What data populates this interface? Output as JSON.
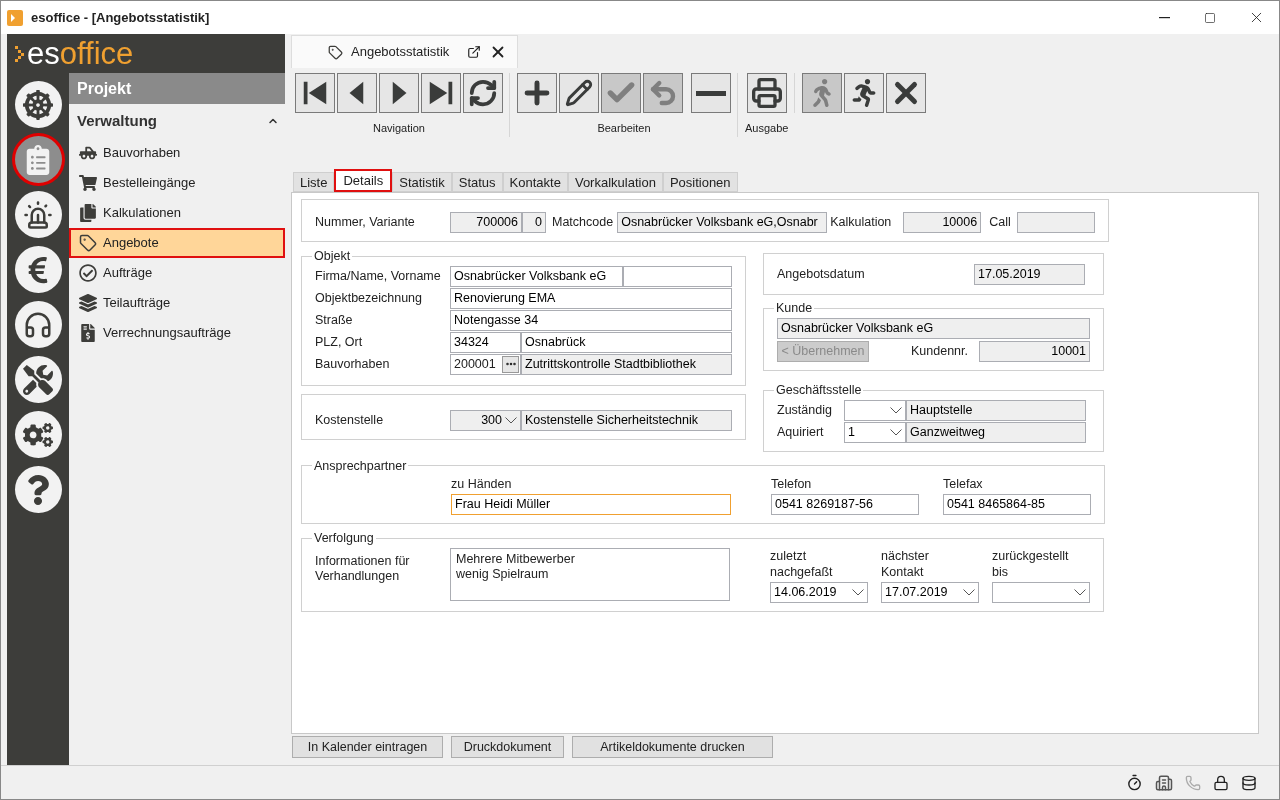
{
  "window": {
    "title": "esoffice - [Angebotsstatistik]"
  },
  "logo": {
    "prefix": "es",
    "suffix": "office"
  },
  "rail": [
    {
      "kind": "wheel",
      "selected": false
    },
    {
      "kind": "project",
      "selected": true
    },
    {
      "kind": "siren",
      "selected": false
    },
    {
      "kind": "euro",
      "selected": false
    },
    {
      "kind": "headset",
      "selected": false
    },
    {
      "kind": "tools",
      "selected": false
    },
    {
      "kind": "cogs",
      "selected": false
    },
    {
      "kind": "help",
      "selected": false
    }
  ],
  "menu": {
    "title": "Projekt",
    "group": {
      "label": "Verwaltung",
      "expanded": true
    },
    "items": [
      {
        "kind": "truck",
        "label": "Bauvorhaben",
        "selected": false
      },
      {
        "kind": "cart",
        "label": "Bestelleingänge",
        "selected": false
      },
      {
        "kind": "docs",
        "label": "Kalkulationen",
        "selected": false
      },
      {
        "kind": "tag",
        "label": "Angebote",
        "selected": true
      },
      {
        "kind": "check",
        "label": "Aufträge",
        "selected": false
      },
      {
        "kind": "layers",
        "label": "Teilaufträge",
        "selected": false
      },
      {
        "kind": "invoice",
        "label": "Verrechnungsaufträge",
        "selected": false
      }
    ]
  },
  "doc_tab": {
    "title": "Angebotsstatistik"
  },
  "toolbar": [
    {
      "label": "Navigation",
      "buttons": [
        {
          "kind": "first",
          "disabled": false
        },
        {
          "kind": "prev",
          "disabled": false
        },
        {
          "kind": "next",
          "disabled": false
        },
        {
          "kind": "last",
          "disabled": false
        },
        {
          "kind": "refresh",
          "disabled": false
        }
      ]
    },
    {
      "label": "Bearbeiten",
      "buttons": [
        {
          "kind": "add",
          "disabled": false
        },
        {
          "kind": "edit",
          "disabled": false
        },
        {
          "kind": "save",
          "disabled": true
        },
        {
          "kind": "undo",
          "disabled": true
        },
        {
          "kind": "delete",
          "disabled": false
        }
      ]
    },
    {
      "label": "Ausgabe",
      "buttons": [
        {
          "kind": "print",
          "disabled": false
        }
      ]
    },
    {
      "buttons": [
        {
          "kind": "walk",
          "disabled": true
        },
        {
          "kind": "run",
          "disabled": false
        },
        {
          "kind": "cancel",
          "disabled": false
        }
      ]
    }
  ],
  "subtabs": [
    {
      "label": "Liste",
      "selected": false
    },
    {
      "label": "Details",
      "selected": true
    },
    {
      "label": "Statistik",
      "selected": false
    },
    {
      "label": "Status",
      "selected": false
    },
    {
      "label": "Kontakte",
      "selected": false
    },
    {
      "label": "Vorkalkulation",
      "selected": false
    },
    {
      "label": "Positionen",
      "selected": false
    }
  ],
  "form": {
    "header": {
      "number_label": "Nummer,  Variante",
      "number": "700006",
      "variant": "0",
      "matchcode_label": "Matchcode",
      "matchcode": "Osnabrücker Volksbank eG,Osnabr",
      "calc_label": "Kalkulation",
      "calc": "10006",
      "call_label": "Call"
    },
    "object": {
      "legend": "Objekt",
      "name_label": "Firma/Name, Vorname",
      "name": "Osnabrücker Volksbank eG",
      "title_label": "Objektbezeichnung",
      "title": "Renovierung EMA",
      "street_label": "Straße",
      "street": "Notengasse 34",
      "city_label": "PLZ, Ort",
      "zip": "34324",
      "city": "Osnabrück",
      "project_label": "Bauvorhaben",
      "project_no": "200001",
      "project_name": "Zutrittskontrolle Stadtbibliothek"
    },
    "cost": {
      "label": "Kostenstelle",
      "number": "300",
      "name": "Kostenstelle Sicherheitstechnik"
    },
    "offer_date": {
      "label": "Angebotsdatum",
      "value": "17.05.2019"
    },
    "customer": {
      "legend": "Kunde",
      "name": "Osnabrücker Volksbank eG",
      "apply_button": "< Übernehmen",
      "apply_disabled": true,
      "number_label": "Kundennr.",
      "number": "10001"
    },
    "office": {
      "legend": "Geschäftsstelle",
      "responsible_label": "Zuständig",
      "responsible": "Hauptstelle",
      "acquired_label": "Aquiriert",
      "acquired_code": "1",
      "acquired": "Ganzweitweg"
    },
    "contact": {
      "legend": "Ansprechpartner",
      "attn_label": "zu Händen",
      "attn": "Frau Heidi Müller",
      "attn_focused": true,
      "phone_label": "Telefon",
      "phone": "0541 8269187-56",
      "fax_label": "Telefax",
      "fax": "0541 8465864-85"
    },
    "tracking": {
      "legend": "Verfolgung",
      "info_label": "Informationen für Verhandlungen",
      "info_lines": [
        "Mehrere Mitbewerber",
        "wenig Spielraum"
      ],
      "last_label": "zuletzt nachgefaßt",
      "last": "14.06.2019",
      "next_label": "nächster Kontakt",
      "next": "17.07.2019",
      "deferred_label": "zurückgestellt bis"
    }
  },
  "actions": [
    "In Kalender eintragen",
    "Druckdokument",
    "Artikeldokumente drucken"
  ]
}
